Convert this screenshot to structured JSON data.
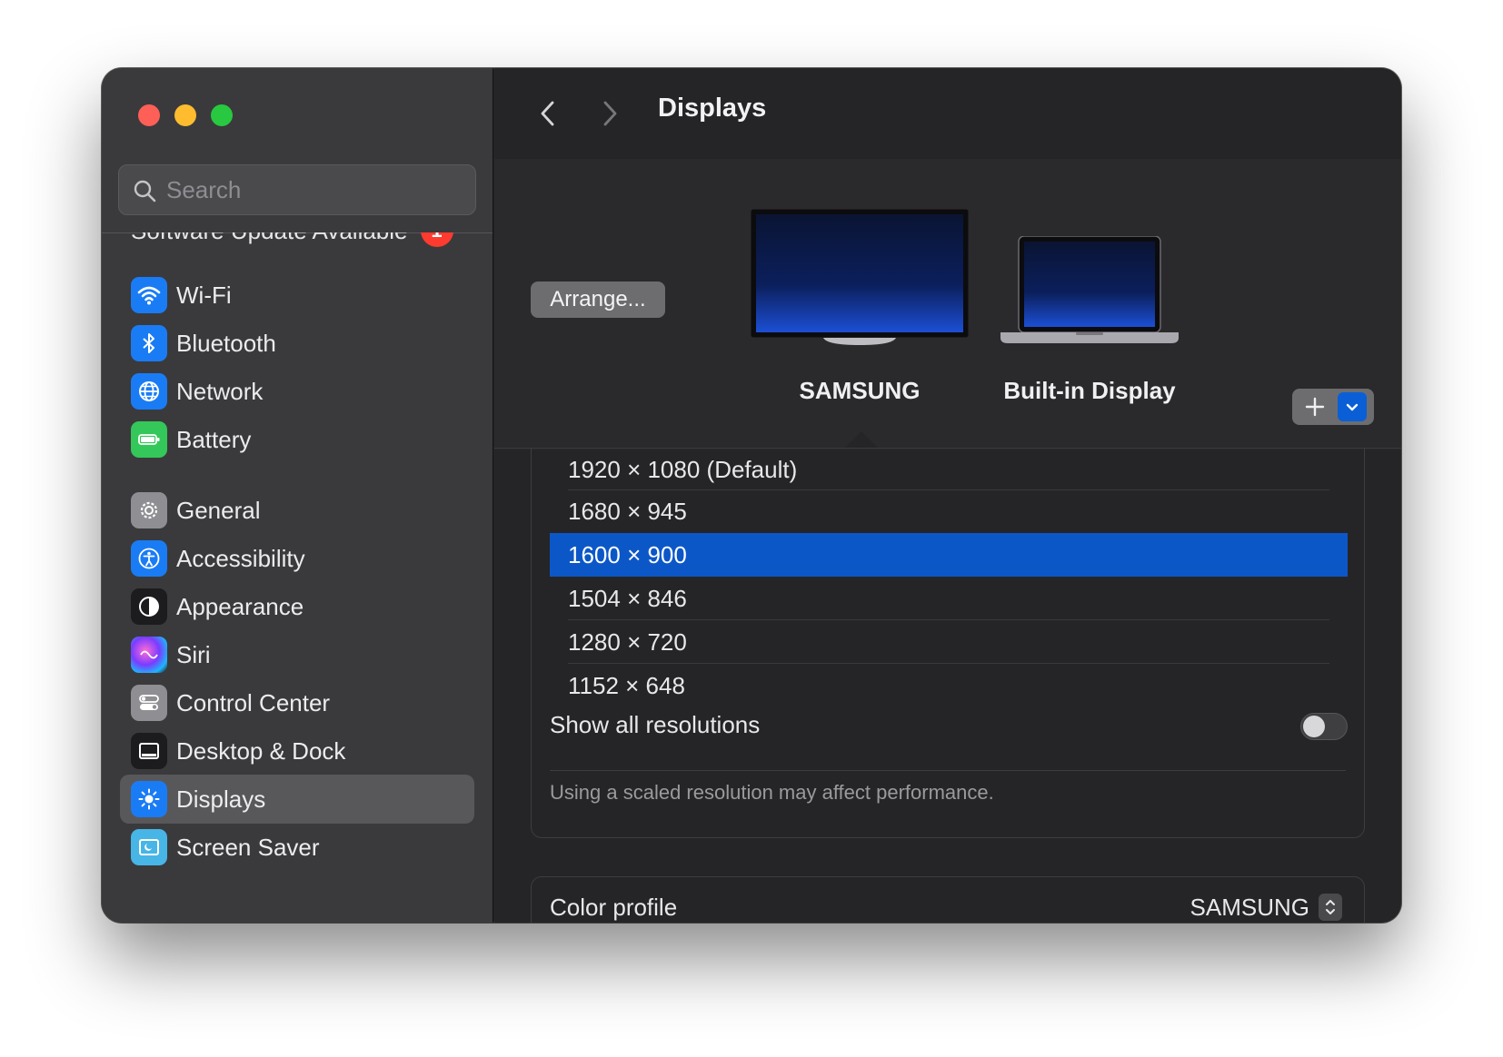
{
  "window": {
    "title": "Displays"
  },
  "search": {
    "placeholder": "Search"
  },
  "sidebar": {
    "update": {
      "label": "Software Update Available",
      "badge": "1"
    },
    "items": [
      {
        "label": "Wi-Fi",
        "icon": "wifi-icon",
        "color": "#1a7cf5"
      },
      {
        "label": "Bluetooth",
        "icon": "bluetooth-icon",
        "color": "#1a7cf5"
      },
      {
        "label": "Network",
        "icon": "globe-icon",
        "color": "#1a7cf5"
      },
      {
        "label": "Battery",
        "icon": "battery-icon",
        "color": "#34c759"
      },
      {
        "label": "General",
        "icon": "gear-icon",
        "color": "#8e8e93"
      },
      {
        "label": "Accessibility",
        "icon": "accessibility-icon",
        "color": "#1a7cf5"
      },
      {
        "label": "Appearance",
        "icon": "appearance-icon",
        "color": "#1c1c1e"
      },
      {
        "label": "Siri",
        "icon": "siri-icon",
        "color": "#2a2a2e"
      },
      {
        "label": "Control Center",
        "icon": "toggles-icon",
        "color": "#8e8e93"
      },
      {
        "label": "Desktop & Dock",
        "icon": "dock-icon",
        "color": "#1c1c1e"
      },
      {
        "label": "Displays",
        "icon": "sun-icon",
        "color": "#1a7cf5",
        "selected": true
      },
      {
        "label": "Screen Saver",
        "icon": "screensaver-icon",
        "color": "#47b5e6"
      }
    ]
  },
  "header": {
    "title": "Displays"
  },
  "displays": {
    "arrange_label": "Arrange...",
    "list": [
      {
        "name": "SAMSUNG",
        "selected": true
      },
      {
        "name": "Built-in Display",
        "selected": false
      }
    ],
    "add_label": "+"
  },
  "resolutions": {
    "options": [
      "1920 × 1080 (Default)",
      "1680 × 945",
      "1600 × 900",
      "1504 × 846",
      "1280 × 720",
      "1152 × 648"
    ],
    "selected": "1600 × 900",
    "show_all_label": "Show all resolutions",
    "show_all_on": false,
    "note": "Using a scaled resolution may affect performance."
  },
  "color_profile": {
    "label": "Color profile",
    "value": "SAMSUNG"
  },
  "colors": {
    "accent": "#0c57c8",
    "sidebar_bg": "#3a3a3c",
    "main_bg": "#252527"
  }
}
